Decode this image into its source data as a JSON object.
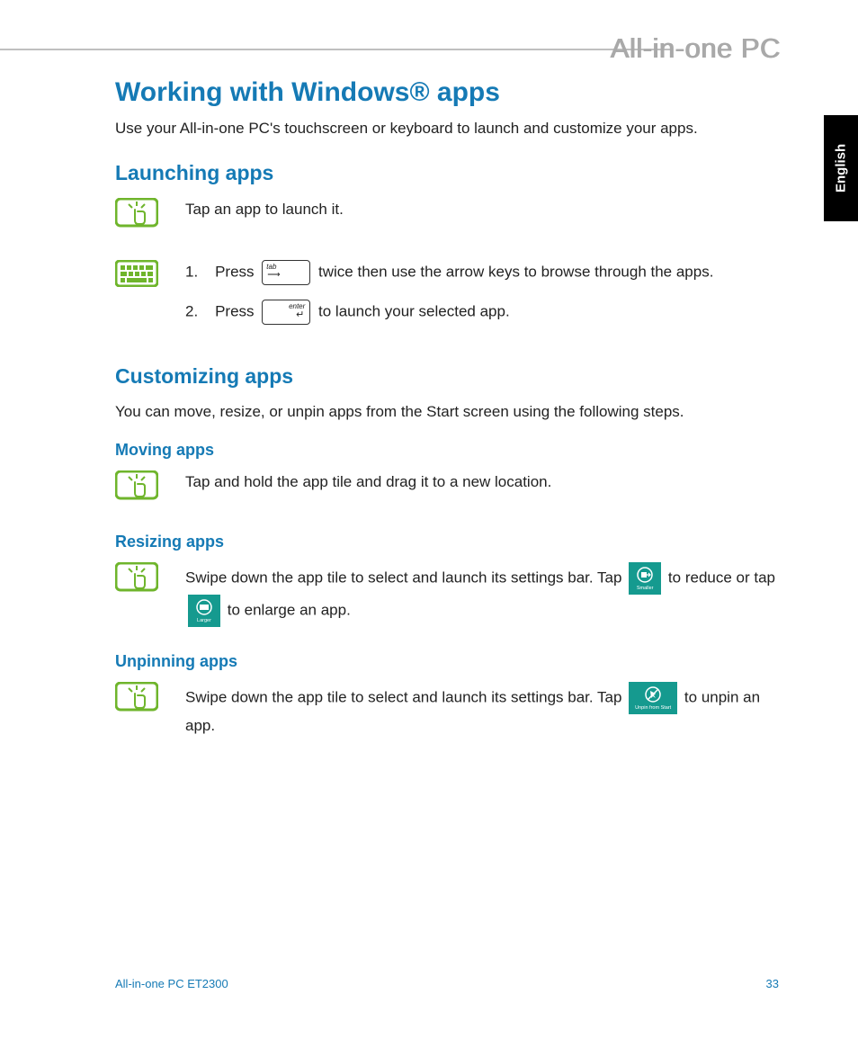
{
  "header": {
    "running_title": "All-in-one PC",
    "lang_tab": "English"
  },
  "main": {
    "h1": "Working with Windows® apps",
    "intro": "Use your All-in-one PC's touchscreen or keyboard to launch and customize your apps.",
    "launching": {
      "heading": "Launching apps",
      "touch_text": "Tap an app to launch it.",
      "step1_prefix": "1.",
      "step1_a": "Press",
      "step1_b": "twice then use the arrow keys to browse through the apps.",
      "step2_prefix": "2.",
      "step2_a": "Press",
      "step2_b": "to launch your selected app."
    },
    "customizing": {
      "heading": "Customizing apps",
      "desc": "You can move, resize, or unpin apps from the Start screen using the following steps.",
      "moving": {
        "heading": "Moving apps",
        "text": "Tap and hold the app tile and drag it to a new location."
      },
      "resizing": {
        "heading": "Resizing apps",
        "text_a": "Swipe down the app tile to select and launch its settings bar. Tap",
        "text_b": "to reduce or tap",
        "text_c": "to enlarge an app.",
        "btn_smaller": "Smaller",
        "btn_larger": "Larger"
      },
      "unpinning": {
        "heading": "Unpinning apps",
        "text_a": "Swipe down the app tile to select and launch its settings bar. Tap",
        "text_b": "to unpin an app.",
        "btn_unpin": "Unpin from Start"
      }
    }
  },
  "footer": {
    "model": "All-in-one PC ET2300",
    "page": "33"
  }
}
